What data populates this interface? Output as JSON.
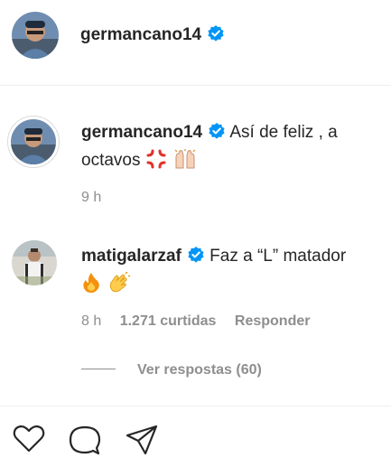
{
  "header": {
    "username": "germancano14",
    "verified_icon": "verified-badge-icon",
    "avatar": "profile-avatar"
  },
  "comments": [
    {
      "username": "germancano14",
      "text": "Así de feliz , a octavos",
      "emojis": [
        "anger-symbol-emoji",
        "raising-hands-emoji"
      ],
      "time": "9 h"
    },
    {
      "username": "matigalarzaf",
      "text": "Faz a “L” matador",
      "emojis": [
        "fire-emoji",
        "clapping-hands-emoji"
      ],
      "time": "8 h",
      "likes": "1.271 curtidas",
      "reply_label": "Responder"
    }
  ],
  "view_replies": "Ver respostas (60)",
  "actions": [
    "heart-icon",
    "comment-icon",
    "share-icon"
  ],
  "colors": {
    "verified": "#0095f6",
    "secondary_text": "#8e8e8e",
    "primary_text": "#262626"
  }
}
